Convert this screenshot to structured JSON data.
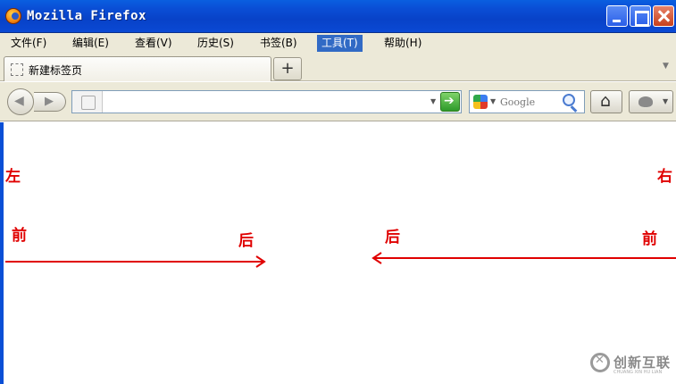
{
  "window": {
    "title": "Mozilla Firefox",
    "colors": {
      "titlebar": "#0a4fd6",
      "close": "#c8401c"
    }
  },
  "menubar": {
    "items": [
      {
        "label": "文件(F)"
      },
      {
        "label": "编辑(E)"
      },
      {
        "label": "查看(V)"
      },
      {
        "label": "历史(S)"
      },
      {
        "label": "书签(B)"
      },
      {
        "label": "工具(T)",
        "active": true
      },
      {
        "label": "帮助(H)"
      }
    ]
  },
  "tabs": {
    "items": [
      {
        "label": "新建标签页"
      }
    ],
    "new_tab_label": "+"
  },
  "navbar": {
    "url_value": "",
    "search_engine_icon": "google-icon",
    "search_placeholder": "Google"
  },
  "content": {
    "labels": {
      "left": "左",
      "right": "右",
      "front_left": "前",
      "back_left": "后",
      "back_right": "后",
      "front_right": "前"
    },
    "arrow_color": "#e00000"
  },
  "watermark": {
    "text": "创新互联",
    "subtext": "CHUANG XIN HU LIAN"
  }
}
